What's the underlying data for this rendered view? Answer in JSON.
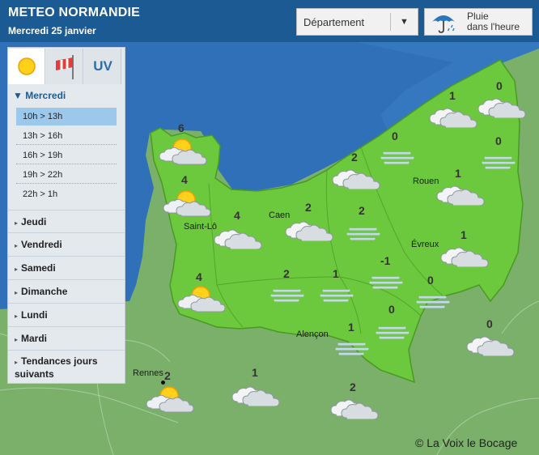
{
  "header": {
    "title": "METEO NORMANDIE",
    "subtitle": "Mercredi 25 janvier",
    "department_label": "Département",
    "rain_line1": "Pluie",
    "rain_line2": "dans l'heure"
  },
  "colors": {
    "header": "#1c5a93",
    "land": "#6cc83c",
    "sea": "#2f70b8",
    "outer_land": "#7ab06a",
    "active_slot": "#9cc8ec"
  },
  "sidebar": {
    "tabs": [
      {
        "name": "sun-icon",
        "active": true
      },
      {
        "name": "windsock-icon",
        "active": false
      },
      {
        "name": "uv-tab",
        "label": "UV",
        "active": false
      }
    ],
    "current_day": "Mercredi",
    "slots": [
      "10h > 13h",
      "13h > 16h",
      "16h > 19h",
      "19h > 22h",
      "22h > 1h"
    ],
    "active_slot": 0,
    "days": [
      "Jeudi",
      "Vendredi",
      "Samedi",
      "Dimanche",
      "Lundi",
      "Mardi",
      "Tendances jours suivants"
    ]
  },
  "cities": [
    {
      "name": "Rouen"
    },
    {
      "name": "Caen"
    },
    {
      "name": "Saint-Lô"
    },
    {
      "name": "Évreux"
    },
    {
      "name": "Alençon"
    },
    {
      "name": "Rennes"
    }
  ],
  "stations": [
    {
      "wind": "0",
      "icon": "cloud-icon"
    },
    {
      "wind": "1",
      "icon": "cloud-icon"
    },
    {
      "wind": "0",
      "icon": "fog-icon"
    },
    {
      "wind": "0",
      "icon": "fog-icon"
    },
    {
      "wind": "6",
      "icon": "partly-sunny-icon"
    },
    {
      "wind": "2",
      "icon": "cloud-icon"
    },
    {
      "wind": "1",
      "icon": "cloud-icon"
    },
    {
      "wind": "4",
      "icon": "partly-sunny-icon"
    },
    {
      "wind": "2",
      "icon": "fog-icon"
    },
    {
      "wind": "2",
      "icon": "cloud-icon"
    },
    {
      "wind": "4",
      "icon": "cloud-icon"
    },
    {
      "wind": "1",
      "icon": "cloud-icon"
    },
    {
      "wind": "-1",
      "icon": "fog-icon"
    },
    {
      "wind": "2",
      "icon": "fog-icon"
    },
    {
      "wind": "1",
      "icon": "fog-icon"
    },
    {
      "wind": "0",
      "icon": "fog-icon"
    },
    {
      "wind": "4",
      "icon": "partly-sunny-icon"
    },
    {
      "wind": "0",
      "icon": "fog-icon"
    },
    {
      "wind": "1",
      "icon": "fog-icon"
    },
    {
      "wind": "0",
      "icon": "cloud-icon"
    },
    {
      "wind": "2",
      "icon": "partly-sunny-icon"
    },
    {
      "wind": "1",
      "icon": "cloud-icon"
    },
    {
      "wind": "2",
      "icon": "cloud-icon"
    }
  ],
  "credit": "© La Voix le Bocage"
}
